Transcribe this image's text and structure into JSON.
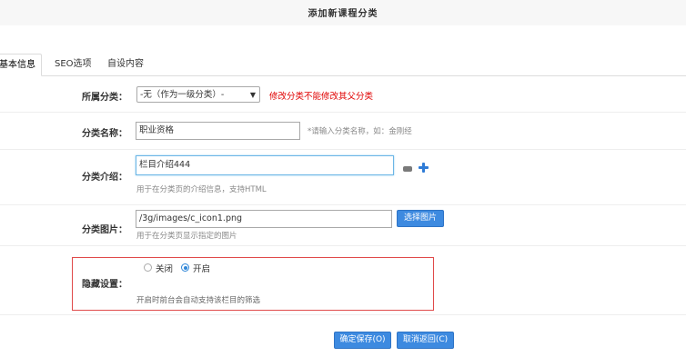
{
  "header": {
    "title": "添加新课程分类"
  },
  "tabs": [
    {
      "label": "基本信息",
      "active": true
    },
    {
      "label": "SEO选项",
      "active": false
    },
    {
      "label": "自设内容",
      "active": false
    }
  ],
  "form": {
    "parent": {
      "label": "所属分类：",
      "selected": "-无（作为一级分类）-",
      "warning": "修改分类不能修改其父分类"
    },
    "name": {
      "label": "分类名称：",
      "value": "职业资格",
      "hint": "*请输入分类名称，如：金刚经"
    },
    "intro": {
      "label": "分类介绍：",
      "value": "栏目介绍444",
      "hint": "用于在分类页的介绍信息，支持HTML"
    },
    "image": {
      "label": "分类图片：",
      "value": "/3g/images/c_icon1.png",
      "button": "选择图片",
      "hint": "用于在分类页显示指定的图片"
    },
    "hidden": {
      "label": "隐藏设置：",
      "options": [
        {
          "label": "关闭",
          "checked": false
        },
        {
          "label": "开启",
          "checked": true
        }
      ],
      "hint": "开启时前台会自动支持该栏目的筛选"
    }
  },
  "actions": {
    "save": "确定保存(O)",
    "cancel": "取消返回(C)"
  },
  "colors": {
    "accent": "#3d8ae0",
    "warning": "#e00000",
    "highlight_border": "#e04a4a"
  }
}
